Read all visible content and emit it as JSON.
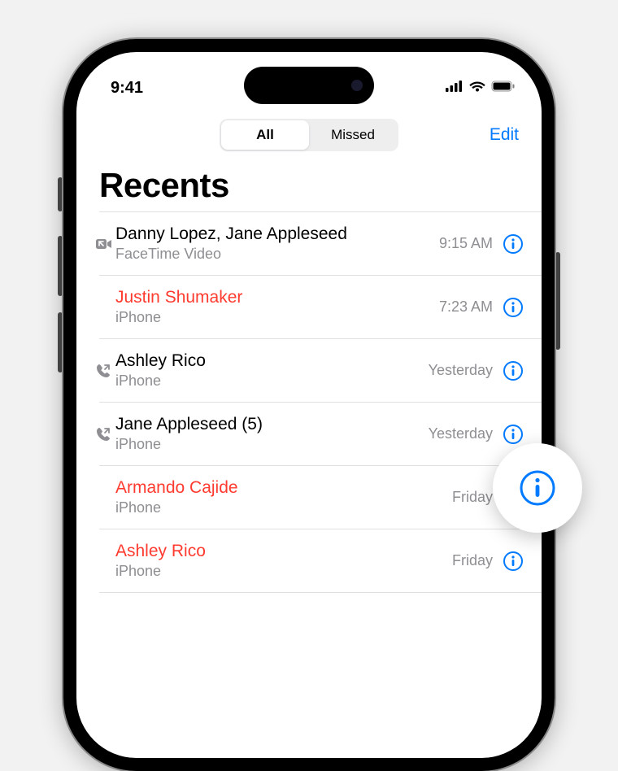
{
  "status": {
    "time": "9:41"
  },
  "header": {
    "segments": {
      "all": "All",
      "missed": "Missed"
    },
    "edit": "Edit"
  },
  "title": "Recents",
  "calls": [
    {
      "name": "Danny Lopez, Jane Appleseed",
      "sub": "FaceTime Video",
      "time": "9:15 AM",
      "missed": false,
      "icon": "video"
    },
    {
      "name": "Justin Shumaker",
      "sub": "iPhone",
      "time": "7:23 AM",
      "missed": true,
      "icon": ""
    },
    {
      "name": "Ashley Rico",
      "sub": "iPhone",
      "time": "Yesterday",
      "missed": false,
      "icon": "outgoing"
    },
    {
      "name": "Jane Appleseed (5)",
      "sub": "iPhone",
      "time": "Yesterday",
      "missed": false,
      "icon": "outgoing"
    },
    {
      "name": "Armando Cajide",
      "sub": "iPhone",
      "time": "Friday",
      "missed": true,
      "icon": ""
    },
    {
      "name": "Ashley Rico",
      "sub": "iPhone",
      "time": "Friday",
      "missed": true,
      "icon": ""
    }
  ],
  "colors": {
    "accent": "#007aff",
    "missed": "#ff3b30",
    "secondary": "#8e8e93"
  }
}
